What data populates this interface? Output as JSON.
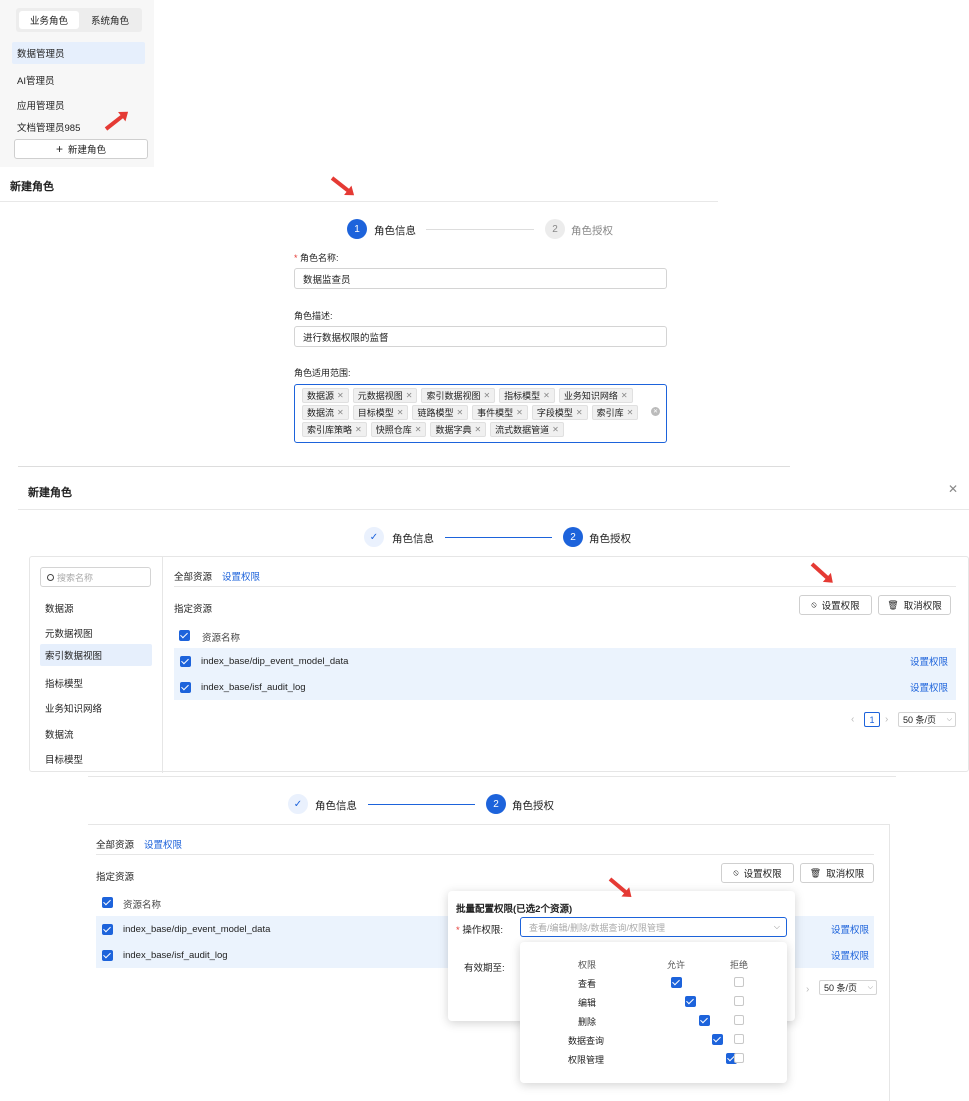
{
  "panel1": {
    "tabs": [
      "业务角色",
      "系统角色"
    ],
    "roles": [
      "数据管理员",
      "AI管理员",
      "应用管理员",
      "文档管理员985"
    ],
    "new_role_button": "新建角色"
  },
  "panel2": {
    "title": "新建角色",
    "steps": [
      {
        "num": "1",
        "label": "角色信息"
      },
      {
        "num": "2",
        "label": "角色授权"
      }
    ],
    "name_label": "角色名称:",
    "name_value": "数据监查员",
    "desc_label": "角色描述:",
    "desc_value": "进行数据权限的监督",
    "scope_label": "角色适用范围:",
    "scope_tags": [
      "数据源",
      "元数据视图",
      "索引数据视图",
      "指标模型",
      "业务知识网络",
      "数据流",
      "目标模型",
      "链路模型",
      "事件模型",
      "字段模型",
      "索引库",
      "索引库策略",
      "快照仓库",
      "数据字典",
      "流式数据管道"
    ]
  },
  "panel3": {
    "title": "新建角色",
    "steps": [
      {
        "label": "角色信息"
      },
      {
        "num": "2",
        "label": "角色授权"
      }
    ],
    "search_placeholder": "搜索名称",
    "categories": [
      "数据源",
      "元数据视图",
      "索引数据视图",
      "指标模型",
      "业务知识网络",
      "数据流",
      "目标模型"
    ],
    "tab_all": "全部资源",
    "tab_set": "设置权限",
    "section_title": "指定资源",
    "set_perm_button": "设置权限",
    "cancel_perm_button": "取消权限",
    "col_header": "资源名称",
    "rows": [
      "index_base/dip_event_model_data",
      "index_base/isf_audit_log"
    ],
    "row_action": "设置权限",
    "page_num": "1",
    "page_size": "50 条/页"
  },
  "panel4": {
    "steps": [
      {
        "label": "角色信息"
      },
      {
        "num": "2",
        "label": "角色授权"
      }
    ],
    "tab_all": "全部资源",
    "tab_set": "设置权限",
    "section_title": "指定资源",
    "set_perm_button": "设置权限",
    "cancel_perm_button": "取消权限",
    "col_header": "资源名称",
    "rows": [
      "index_base/dip_event_model_data",
      "index_base/isf_audit_log"
    ],
    "row_action": "设置权限",
    "page_size": "50 条/页",
    "popup": {
      "title": "批量配置权限(已选2个资源)",
      "op_label": "操作权限:",
      "op_placeholder": "查看/编辑/删除/数据查询/权限管理",
      "expire_label": "有效期至:",
      "table_headers": [
        "权限",
        "允许",
        "拒绝"
      ],
      "perms": [
        "查看",
        "编辑",
        "删除",
        "数据查询",
        "权限管理"
      ]
    }
  },
  "colors": {
    "primary": "#1d63db",
    "annotation_arrow": "#e53a34",
    "row_highlight": "#ebf3fd"
  }
}
